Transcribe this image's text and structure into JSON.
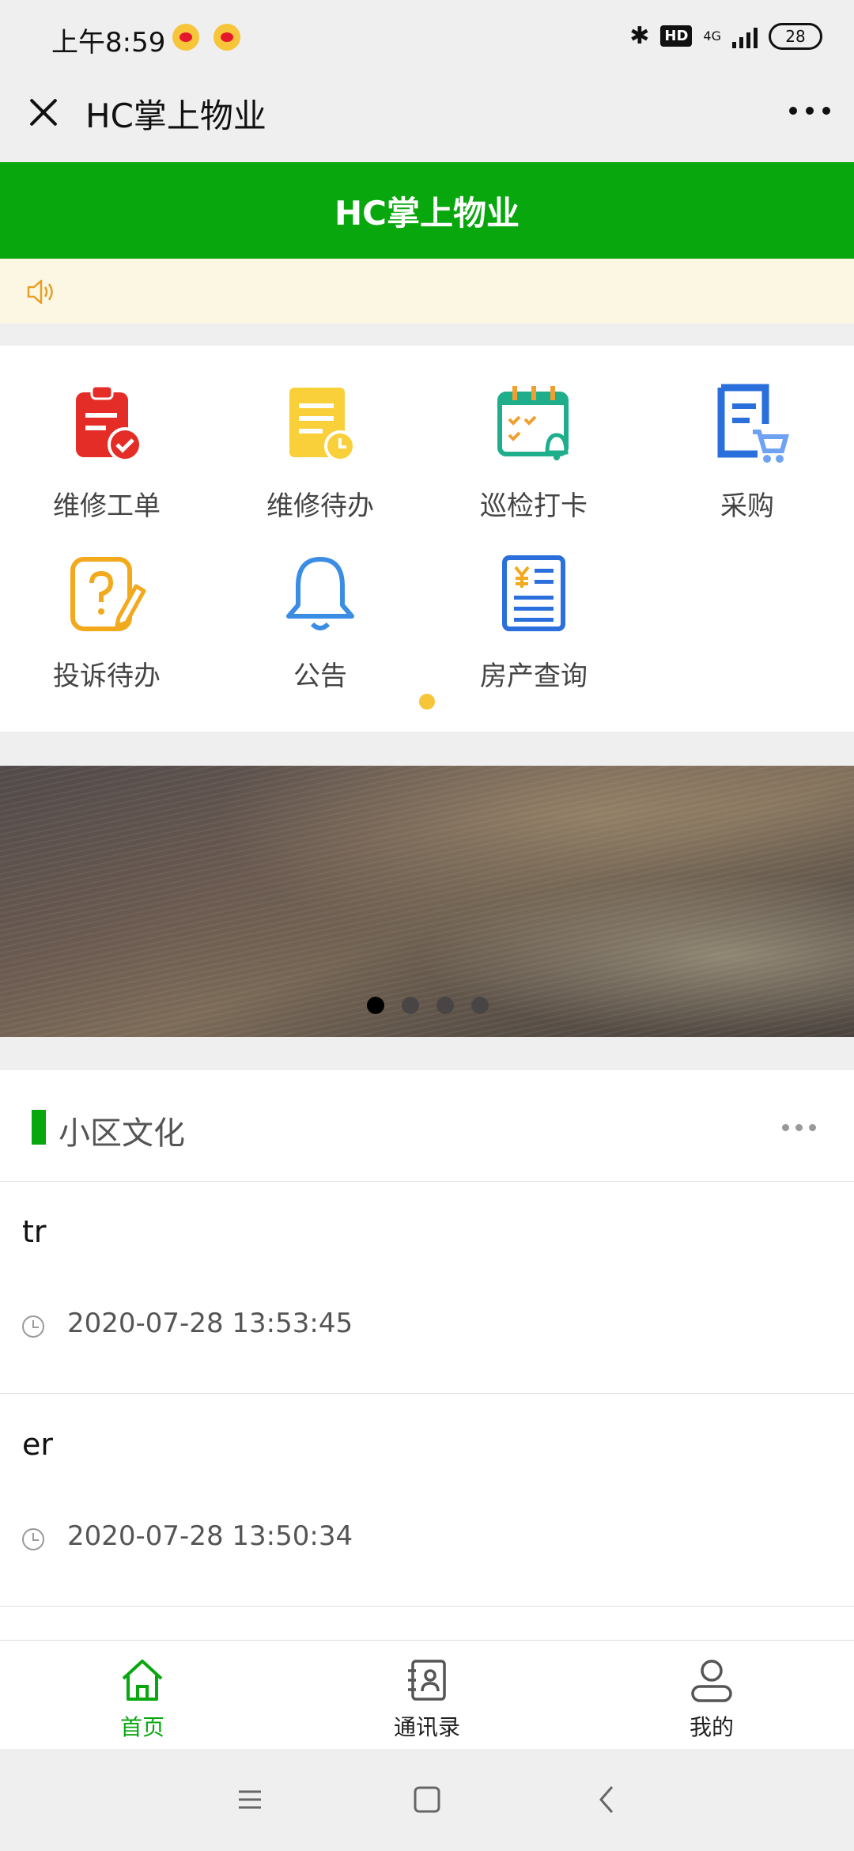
{
  "status": {
    "time": "上午8:59",
    "hd": "HD",
    "network": "4G",
    "battery": "28"
  },
  "nav": {
    "title": "HC掌上物业"
  },
  "header": {
    "title": "HC掌上物业"
  },
  "menu": {
    "items": [
      {
        "label": "维修工单",
        "icon": "repair-order-icon"
      },
      {
        "label": "维修待办",
        "icon": "repair-todo-icon"
      },
      {
        "label": "巡检打卡",
        "icon": "patrol-checkin-icon"
      },
      {
        "label": "采购",
        "icon": "purchase-icon"
      },
      {
        "label": "投诉待办",
        "icon": "complaint-todo-icon"
      },
      {
        "label": "公告",
        "icon": "announcement-bell-icon"
      },
      {
        "label": "房产查询",
        "icon": "property-query-icon"
      }
    ]
  },
  "culture": {
    "title": "小区文化",
    "items": [
      {
        "title": "tr",
        "time": "2020-07-28 13:53:45"
      },
      {
        "title": "er",
        "time": "2020-07-28 13:50:34"
      }
    ]
  },
  "tabs": [
    {
      "label": "首页",
      "icon": "home-icon",
      "active": true
    },
    {
      "label": "通讯录",
      "icon": "contacts-icon",
      "active": false
    },
    {
      "label": "我的",
      "icon": "profile-icon",
      "active": false
    }
  ],
  "colors": {
    "brand_green": "#08a70e",
    "notice_bg": "#fcf7e2",
    "indicator_yellow": "#f7c53a"
  }
}
